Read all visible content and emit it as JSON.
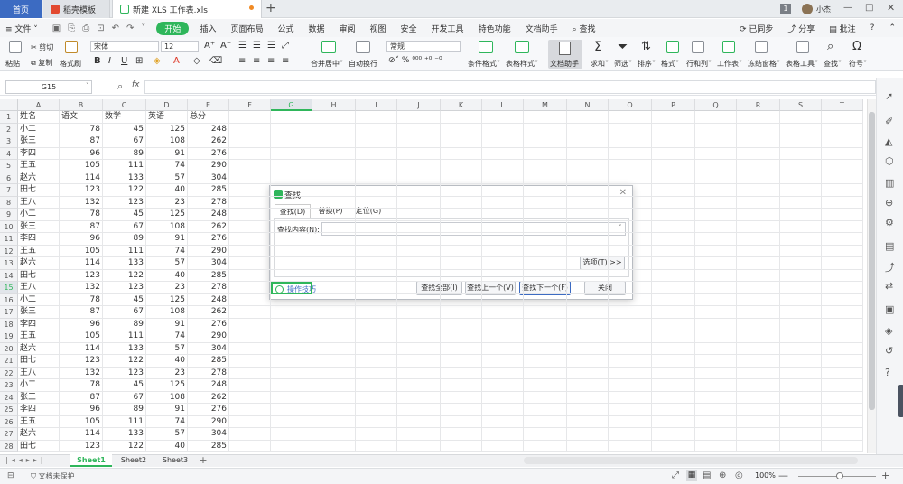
{
  "titlebar": {
    "home_tab": "首页",
    "doc_tab": "稻壳模板",
    "file_tab": "新建 XLS 工作表.xls",
    "user_name": "小杰",
    "badge": "1"
  },
  "menubar": {
    "file": "文件",
    "items": [
      "开始",
      "插入",
      "页面布局",
      "公式",
      "数据",
      "审阅",
      "视图",
      "安全",
      "开发工具",
      "特色功能",
      "文档助手"
    ],
    "search": "查找",
    "sync": "已同步",
    "share": "分享",
    "comment": "批注"
  },
  "ribbon": {
    "paste": "粘贴",
    "cut": "剪切",
    "copy": "复制",
    "format_painter": "格式刷",
    "font_name": "宋体",
    "font_size": "12",
    "merge": "合并居中",
    "wrap": "自动换行",
    "number_format": "常规",
    "cond_format": "条件格式",
    "table_style": "表格样式",
    "doc_helper": "文档助手",
    "sum": "求和",
    "filter": "筛选",
    "sort": "排序",
    "format": "格式",
    "row_col": "行和列",
    "worksheet": "工作表",
    "freeze": "冻结窗格",
    "table_tools": "表格工具",
    "find": "查找",
    "symbol": "符号"
  },
  "formula_bar": {
    "cell_ref": "G15",
    "fx": "fx",
    "value": ""
  },
  "columns": [
    "A",
    "B",
    "C",
    "D",
    "E",
    "F",
    "G",
    "H",
    "I",
    "J",
    "K",
    "L",
    "M",
    "N",
    "O",
    "P",
    "Q",
    "R",
    "S",
    "T"
  ],
  "rows": [
    [
      "姓名",
      "语文",
      "数学",
      "英语",
      "总分"
    ],
    [
      "小二",
      "78",
      "45",
      "125",
      "248"
    ],
    [
      "张三",
      "87",
      "67",
      "108",
      "262"
    ],
    [
      "李四",
      "96",
      "89",
      "91",
      "276"
    ],
    [
      "王五",
      "105",
      "111",
      "74",
      "290"
    ],
    [
      "赵六",
      "114",
      "133",
      "57",
      "304"
    ],
    [
      "田七",
      "123",
      "122",
      "40",
      "285"
    ],
    [
      "王八",
      "132",
      "123",
      "23",
      "278"
    ],
    [
      "小二",
      "78",
      "45",
      "125",
      "248"
    ],
    [
      "张三",
      "87",
      "67",
      "108",
      "262"
    ],
    [
      "李四",
      "96",
      "89",
      "91",
      "276"
    ],
    [
      "王五",
      "105",
      "111",
      "74",
      "290"
    ],
    [
      "赵六",
      "114",
      "133",
      "57",
      "304"
    ],
    [
      "田七",
      "123",
      "122",
      "40",
      "285"
    ],
    [
      "王八",
      "132",
      "123",
      "23",
      "278"
    ],
    [
      "小二",
      "78",
      "45",
      "125",
      "248"
    ],
    [
      "张三",
      "87",
      "67",
      "108",
      "262"
    ],
    [
      "李四",
      "96",
      "89",
      "91",
      "276"
    ],
    [
      "王五",
      "105",
      "111",
      "74",
      "290"
    ],
    [
      "赵六",
      "114",
      "133",
      "57",
      "304"
    ],
    [
      "田七",
      "123",
      "122",
      "40",
      "285"
    ],
    [
      "王八",
      "132",
      "123",
      "23",
      "278"
    ],
    [
      "小二",
      "78",
      "45",
      "125",
      "248"
    ],
    [
      "张三",
      "87",
      "67",
      "108",
      "262"
    ],
    [
      "李四",
      "96",
      "89",
      "91",
      "276"
    ],
    [
      "王五",
      "105",
      "111",
      "74",
      "290"
    ],
    [
      "赵六",
      "114",
      "133",
      "57",
      "304"
    ],
    [
      "田七",
      "123",
      "122",
      "40",
      "285"
    ]
  ],
  "selected_row": 15,
  "sheets": [
    "Sheet1",
    "Sheet2",
    "Sheet3"
  ],
  "active_sheet": "Sheet1",
  "status": {
    "protect": "文档未保护",
    "zoom": "100%"
  },
  "dialog": {
    "title": "查找",
    "tabs": [
      "查找(D)",
      "替换(P)",
      "定位(G)"
    ],
    "find_label": "查找内容(N):",
    "find_value": "",
    "options_button": "选项(T) >>",
    "tips_link": "操作技巧",
    "find_all": "查找全部(I)",
    "find_prev": "查找上一个(V)",
    "find_next": "查找下一个(F)",
    "close": "关闭"
  },
  "colors": {
    "accent": "#2fb65b",
    "home_tab": "#3c6bc2",
    "sheet_active": "#2fb65b"
  }
}
